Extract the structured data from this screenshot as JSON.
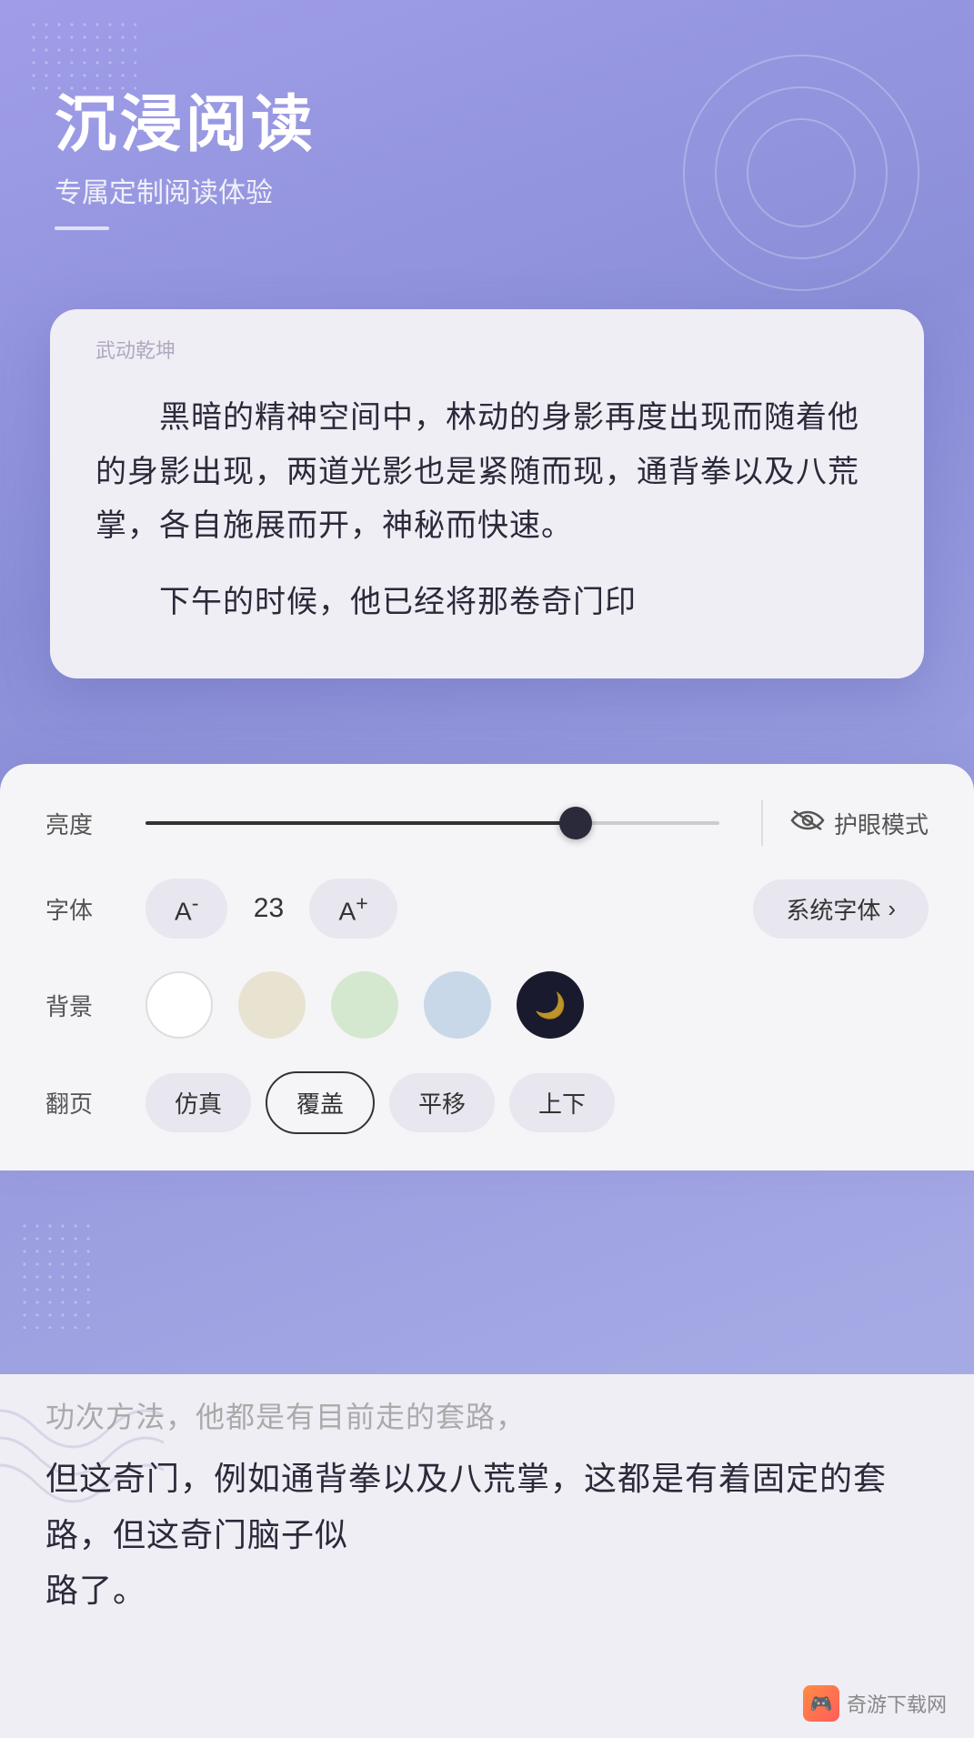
{
  "header": {
    "title": "沉浸阅读",
    "subtitle": "专属定制阅读体验"
  },
  "reading": {
    "book_title": "武动乾坤",
    "paragraph1": "　　黑暗的精神空间中，林动的身影再度出现而随着他的身影出现，两道光影也是紧随而现，通背拳以及八荒掌，各自施展而开，神秘而快速。",
    "paragraph2": "　　下午的时候，他已经将那卷奇门印",
    "lower_text1": "功次方法，他都是有目前走的套路，",
    "lower_text2": "但这奇门，例如通背拳以及八荒掌，这都是有着固定的套路，但这奇门脑子似",
    "lower_text3": "路了。"
  },
  "settings": {
    "brightness_label": "亮度",
    "brightness_value": 75,
    "eye_mode_label": "护眼模式",
    "font_label": "字体",
    "font_size": "23",
    "font_decrease_label": "A⁻",
    "font_increase_label": "A⁺",
    "font_family_label": "系统字体",
    "bg_label": "背景",
    "bg_options": [
      "white",
      "beige",
      "green",
      "blue-gray",
      "dark"
    ],
    "flip_label": "翻页",
    "flip_options": [
      "仿真",
      "覆盖",
      "平移",
      "上下"
    ],
    "flip_active": "覆盖"
  },
  "watermark": {
    "text": "奇游下载网"
  }
}
